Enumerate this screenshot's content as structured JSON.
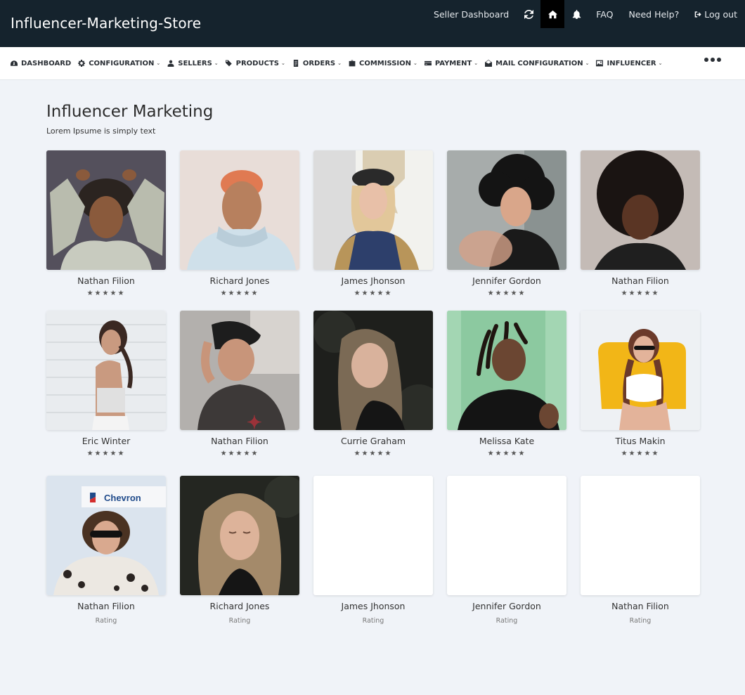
{
  "header": {
    "brand": "Influencer-Marketing-Store",
    "seller_dashboard": "Seller Dashboard",
    "faq": "FAQ",
    "help": "Need Help?",
    "logout": "Log out",
    "icons": [
      "refresh-icon",
      "home-icon",
      "bell-icon",
      "logout-icon"
    ]
  },
  "nav": {
    "items": [
      {
        "label": "DASHBOARD",
        "icon": "dashboard-icon",
        "dropdown": false
      },
      {
        "label": "CONFIGURATION",
        "icon": "gear-icon",
        "dropdown": true
      },
      {
        "label": "SELLERS",
        "icon": "users-icon",
        "dropdown": true
      },
      {
        "label": "PRODUCTS",
        "icon": "tags-icon",
        "dropdown": true
      },
      {
        "label": "ORDERS",
        "icon": "clipboard-icon",
        "dropdown": true
      },
      {
        "label": "COMMISSION",
        "icon": "briefcase-icon",
        "dropdown": true
      },
      {
        "label": "PAYMENT",
        "icon": "card-icon",
        "dropdown": true
      },
      {
        "label": "MAIL CONFIGURATION",
        "icon": "mail-icon",
        "dropdown": true
      },
      {
        "label": "INFLUENCER",
        "icon": "image-icon",
        "dropdown": true
      }
    ],
    "caret": "⌄"
  },
  "main": {
    "title": "Influencer Marketing",
    "subtitle": "Lorem Ipsume is simply text"
  },
  "influencers": [
    {
      "name": "Nathan Filion",
      "stars": "★★★★★",
      "rating": 5,
      "photo": "man-cap-gray"
    },
    {
      "name": "Richard Jones",
      "stars": "★★★★★",
      "rating": 5,
      "photo": "man-orange-hair"
    },
    {
      "name": "James Jhonson",
      "stars": "★★★★★",
      "rating": 5,
      "photo": "woman-blonde-beanie"
    },
    {
      "name": "Jennifer Gordon",
      "stars": "★★★★★",
      "rating": 5,
      "photo": "woman-curly-hair"
    },
    {
      "name": "Nathan Filion",
      "stars": "★★★★★",
      "rating": 5,
      "photo": "woman-afro"
    },
    {
      "name": "Eric Winter",
      "stars": "★★★★★",
      "rating": 5,
      "photo": "woman-white-wall"
    },
    {
      "name": "Nathan Filion",
      "stars": "★★★★★",
      "rating": 5,
      "photo": "man-beanie"
    },
    {
      "name": "Currie Graham",
      "stars": "★★★★★",
      "rating": 5,
      "photo": "woman-smiling-dark"
    },
    {
      "name": "Melissa Kate",
      "stars": "★★★★★",
      "rating": 5,
      "photo": "man-dreadlocks"
    },
    {
      "name": "Titus Makin",
      "stars": "★★★★★",
      "rating": 5,
      "photo": "woman-yellow-chair"
    },
    {
      "name": "Nathan Filion",
      "rating_label": "Rating",
      "photo": "woman-sunglasses-chevron",
      "photo_text": "Chevron"
    },
    {
      "name": "Richard Jones",
      "rating_label": "Rating",
      "photo": "woman-eyes-closed"
    },
    {
      "name": "James Jhonson",
      "rating_label": "Rating",
      "photo": "empty"
    },
    {
      "name": "Jennifer Gordon",
      "rating_label": "Rating",
      "photo": "empty"
    },
    {
      "name": "Nathan Filion",
      "rating_label": "Rating",
      "photo": "empty"
    }
  ],
  "colors": {
    "header_bg": "#15232d",
    "page_bg": "#f0f3f8",
    "active_icon_bg": "#000000"
  }
}
